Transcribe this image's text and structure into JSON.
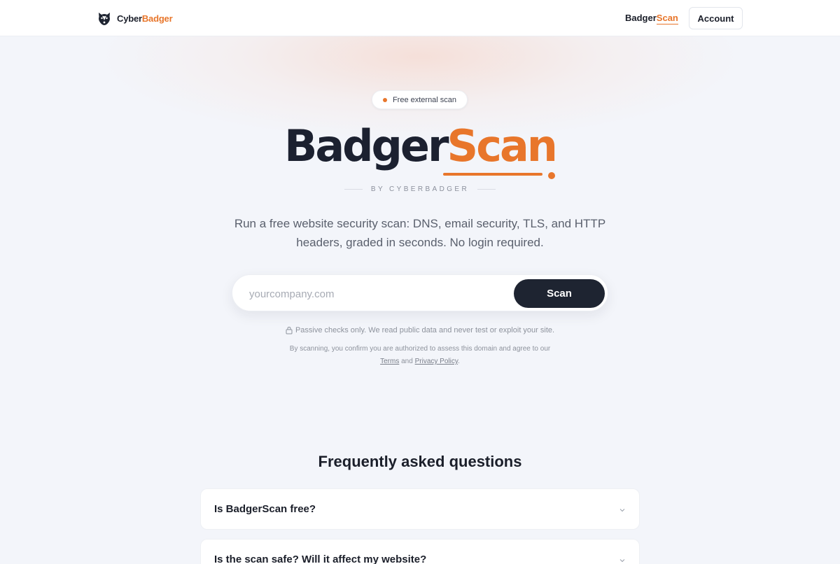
{
  "header": {
    "brand_name_1": "Cyber",
    "brand_name_2": "Badger",
    "nav_product_1": "Badger",
    "nav_product_2": "Scan",
    "account_label": "Account"
  },
  "hero": {
    "pill_label": "Free external scan",
    "title_dark": "Badger",
    "title_orange": "Scan",
    "byline": "BY CYBERBADGER",
    "subtitle": "Run a free website security scan: DNS, email security, TLS, and HTTP headers, graded in seconds. No login required."
  },
  "search": {
    "placeholder": "yourcompany.com",
    "value": "",
    "button_label": "Scan"
  },
  "notice": {
    "text": "Passive checks only. We read public data and never test or exploit your site.",
    "legal_prefix": "By scanning, you confirm you are authorized to assess this domain and agree to our",
    "terms_label": "Terms",
    "and": "and",
    "privacy_label": "Privacy Policy",
    "period": "."
  },
  "faq": {
    "title": "Frequently asked questions",
    "items": [
      {
        "question": "Is BadgerScan free?"
      },
      {
        "question": "Is the scan safe? Will it affect my website?"
      }
    ]
  },
  "colors": {
    "accent": "#e8762b",
    "dark": "#1e2431",
    "background": "#f3f5fa"
  }
}
